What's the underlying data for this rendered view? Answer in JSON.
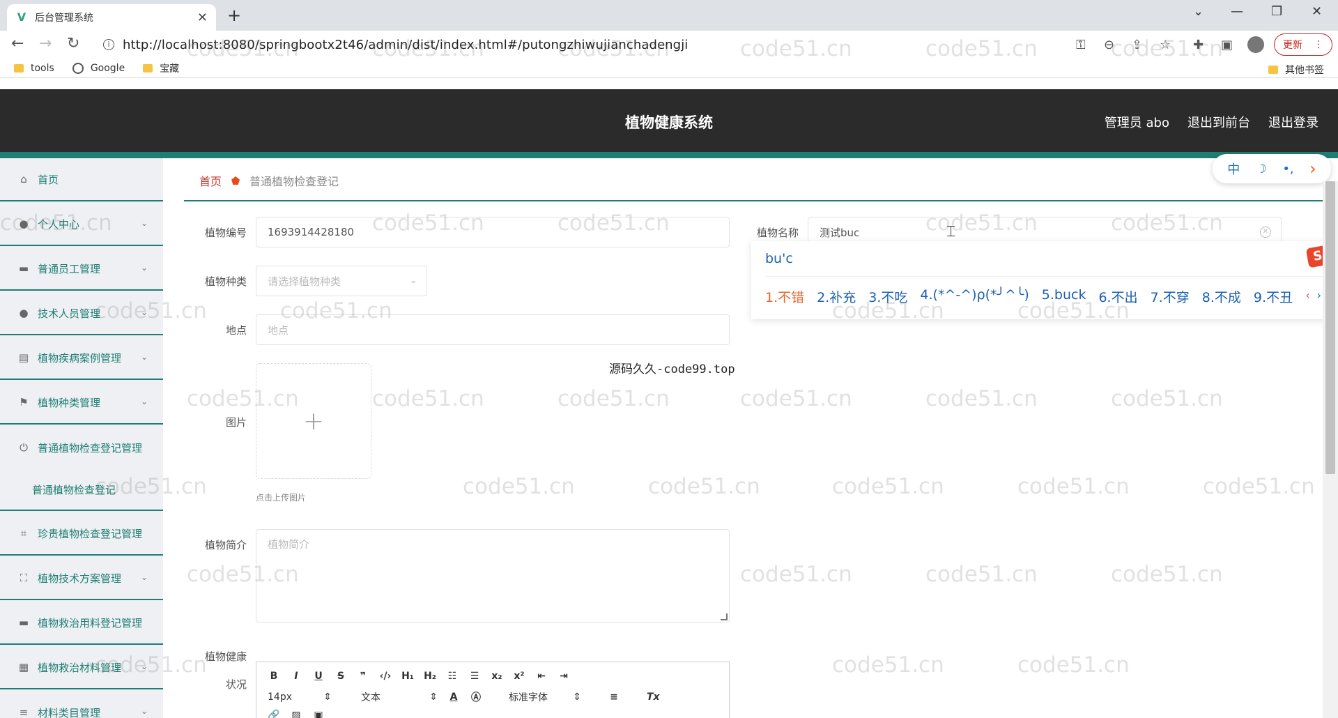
{
  "browser": {
    "tab_title": "后台管理系统",
    "url": "http://localhost:8080/springbootx2t46/admin/dist/index.html#/putongzhiwujianchadengji",
    "update_label": "更新",
    "bookmarks": [
      "tools",
      "Google",
      "宝藏"
    ],
    "other_bookmarks": "其他书签"
  },
  "header": {
    "title": "植物健康系统",
    "links": [
      "管理员 abo",
      "退出到前台",
      "退出登录"
    ]
  },
  "sidebar": {
    "items": [
      {
        "label": "首页",
        "icon": "home-icon"
      },
      {
        "label": "个人中心",
        "icon": "user-icon"
      },
      {
        "label": "普通员工管理",
        "icon": "monitor-icon"
      },
      {
        "label": "技术人员管理",
        "icon": "location-icon"
      },
      {
        "label": "植物疾病案例管理",
        "icon": "printer-icon"
      },
      {
        "label": "植物种类管理",
        "icon": "flag-icon"
      },
      {
        "label": "普通植物检查登记管理",
        "icon": "power-icon"
      },
      {
        "label": "普通植物检查登记",
        "icon": ""
      },
      {
        "label": "珍贵植物检查登记管理",
        "icon": "crop-icon"
      },
      {
        "label": "植物技术方案管理",
        "icon": "fullscreen-icon"
      },
      {
        "label": "植物救治用料登记管理",
        "icon": "monitor-icon"
      },
      {
        "label": "植物救治材料管理",
        "icon": "document-icon"
      },
      {
        "label": "材料类目管理",
        "icon": "list-icon"
      }
    ]
  },
  "breadcrumb": {
    "home": "首页",
    "current": "普通植物检查登记"
  },
  "form": {
    "plant_no_label": "植物编号",
    "plant_no_value": "1693914428180",
    "plant_name_label": "植物名称",
    "plant_name_value": "测试buc",
    "plant_type_label": "植物种类",
    "plant_type_placeholder": "请选择植物种类",
    "location_label": "地点",
    "location_placeholder": "地点",
    "image_label": "图片",
    "upload_hint": "点击上传图片",
    "intro_label": "植物简介",
    "intro_placeholder": "植物简介",
    "health_label_1": "植物健康",
    "health_label_2": "状况"
  },
  "editor": {
    "font_size": "14px",
    "text_style": "文本",
    "font_family": "标准字体"
  },
  "center_note": "源码久久-code99.top",
  "ime": {
    "pinyin": "bu'c",
    "candidates": [
      "1.不错",
      "2.补充",
      "3.不吃",
      "4.(*^-^)ρ(*╯^╰)",
      "5.buck",
      "6.不出",
      "7.不穿",
      "8.不成",
      "9.不丑"
    ],
    "toolbar": [
      "中",
      "☽",
      "•,",
      "›"
    ],
    "logo": "S"
  },
  "watermark": "code51.cn",
  "colors": {
    "accent": "#1e7d74",
    "header_bg": "#2b2b2b",
    "breadcrumb_home": "#c0392b"
  }
}
